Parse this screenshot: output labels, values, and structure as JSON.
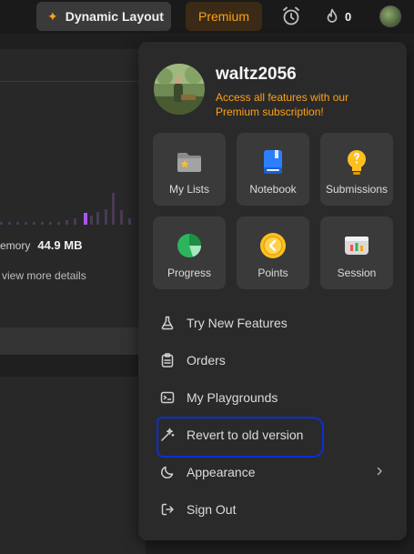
{
  "topbar": {
    "dynamic_layout_label": "Dynamic Layout",
    "premium_label": "Premium",
    "streak_count": "0"
  },
  "background": {
    "memory_label": "emory",
    "memory_value": "44.9 MB",
    "view_more": "view more details"
  },
  "menu": {
    "username": "waltz2056",
    "promo": "Access all features with our Premium subscription!",
    "tiles": [
      {
        "label": "My Lists",
        "icon": "folder-icon"
      },
      {
        "label": "Notebook",
        "icon": "notebook-icon"
      },
      {
        "label": "Submissions",
        "icon": "lightbulb-icon"
      },
      {
        "label": "Progress",
        "icon": "progress-pie-icon"
      },
      {
        "label": "Points",
        "icon": "coin-icon"
      },
      {
        "label": "Session",
        "icon": "session-icon"
      }
    ],
    "items": [
      {
        "label": "Try New Features",
        "icon": "flask-icon"
      },
      {
        "label": "Orders",
        "icon": "clipboard-icon"
      },
      {
        "label": "My Playgrounds",
        "icon": "terminal-icon"
      },
      {
        "label": "Revert to old version",
        "icon": "wand-icon"
      },
      {
        "label": "Appearance",
        "icon": "moon-icon"
      },
      {
        "label": "Sign Out",
        "icon": "sign-out-icon"
      }
    ]
  },
  "colors": {
    "accent": "#ffa116",
    "annotation": "#0a2fd6",
    "menu_bg": "#2a2a2a",
    "tile_bg": "#3a3a3a"
  }
}
